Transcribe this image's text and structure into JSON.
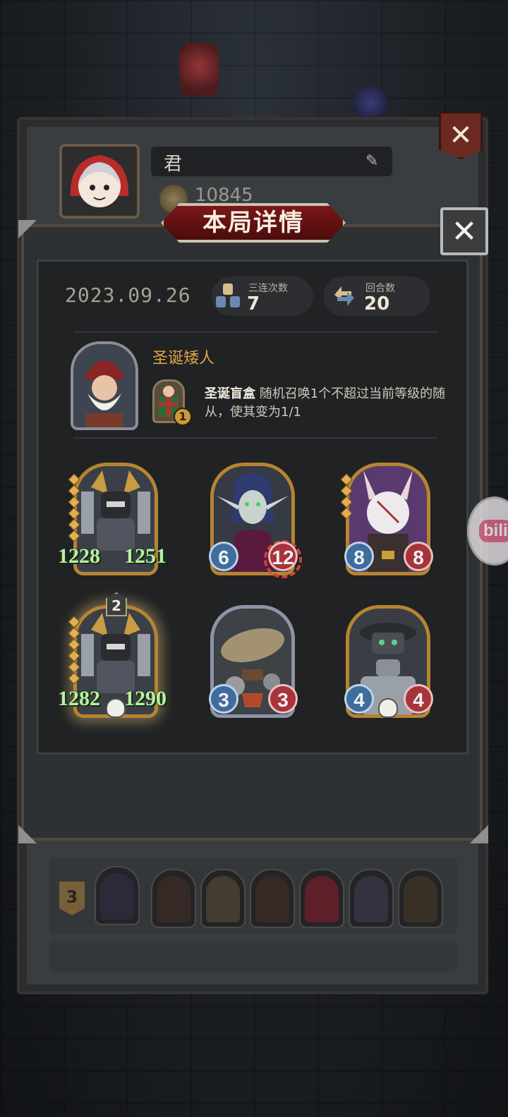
{
  "profile": {
    "name": "君",
    "coins": "10845"
  },
  "dialog": {
    "title": "本局详情",
    "date": "2023.09.26",
    "triples_label": "三连次数",
    "triples_value": "7",
    "turns_label": "回合数",
    "turns_value": "20"
  },
  "hero": {
    "name": "圣诞矮人",
    "power_level": "1",
    "power_name": "圣诞盲盒",
    "power_desc": "随机召唤1个不超过当前等级的随从，使其变为1/1"
  },
  "units": [
    {
      "attack": "1228",
      "health": "1251",
      "big": true,
      "frame": "gold",
      "icon": "robot-golem-icon"
    },
    {
      "attack": "6",
      "health": "12",
      "big": false,
      "frame": "gold",
      "icon": "elf-sorceress-icon"
    },
    {
      "attack": "8",
      "health": "8",
      "big": false,
      "frame": "gold",
      "icon": "masked-rat-icon"
    },
    {
      "attack": "1282",
      "health": "1290",
      "big": true,
      "frame": "gold",
      "icon": "robot-golem-icon",
      "tier": "2"
    },
    {
      "attack": "3",
      "health": "3",
      "big": false,
      "frame": "silver",
      "icon": "airship-icon"
    },
    {
      "attack": "4",
      "health": "4",
      "big": false,
      "frame": "gold",
      "icon": "tin-robot-icon"
    }
  ],
  "history": {
    "rank": "3"
  },
  "watermark": "bili",
  "colors": {
    "title_plate": "#7b1717",
    "hero_name": "#e0a348",
    "attack": "#3e6d9e",
    "health": "#a8333a",
    "big_stat": "#b8f0a6",
    "gold_frame": "#b68432"
  }
}
